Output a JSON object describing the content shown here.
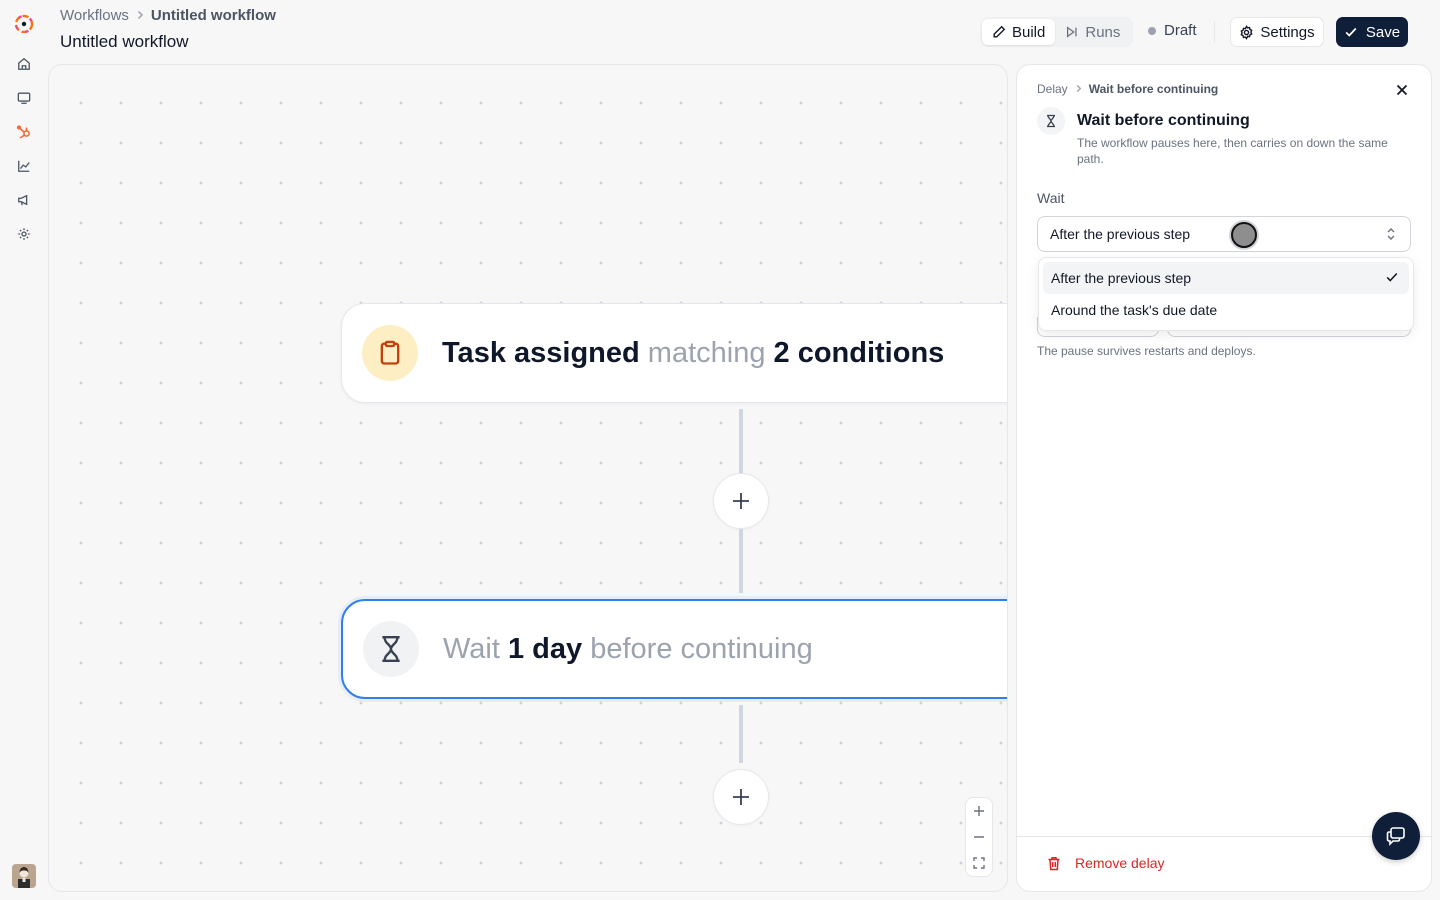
{
  "breadcrumb": {
    "root": "Workflows",
    "current": "Untitled workflow"
  },
  "page_title": "Untitled workflow",
  "tabs": [
    {
      "label": "Build",
      "active": true
    },
    {
      "label": "Runs",
      "active": false
    }
  ],
  "status": {
    "label": "Draft"
  },
  "settings_label": "Settings",
  "save_label": "Save",
  "nav_icons": [
    "home-icon",
    "monitor-icon",
    "hubspot-icon",
    "chart-icon",
    "megaphone-icon",
    "settings-icon"
  ],
  "nodes": {
    "trigger": {
      "bold1": "Task assigned",
      "muted": "matching",
      "bold2": "2 conditions"
    },
    "delay": {
      "muted1": "Wait",
      "bold": "1 day",
      "muted2": "before continuing"
    }
  },
  "panel": {
    "breadcrumb": {
      "root": "Delay",
      "current": "Wait before continuing"
    },
    "title": "Wait before continuing",
    "description": "The workflow pauses here, then carries on down the same path.",
    "wait_label": "Wait",
    "select_value": "After the previous step",
    "options": [
      {
        "label": "After the previous step",
        "selected": true
      },
      {
        "label": "Around the task's due date",
        "selected": false
      }
    ],
    "note": "The pause survives restarts and deploys.",
    "remove_label": "Remove delay"
  },
  "colors": {
    "accent": "#2f80ed",
    "primary": "#0f1f3a",
    "danger": "#dc2626",
    "trigger_icon_bg": "#fdefc3"
  }
}
